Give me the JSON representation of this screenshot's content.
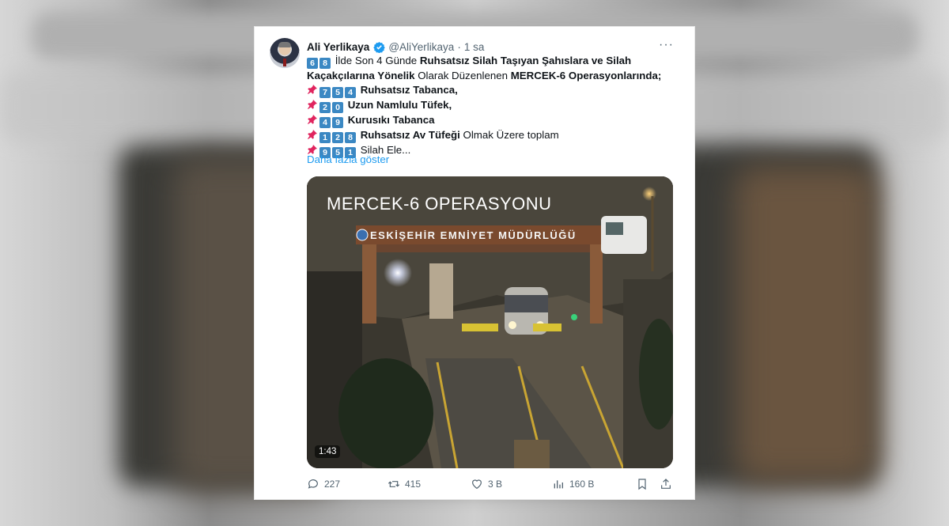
{
  "tweet": {
    "author_name": "Ali Yerlikaya",
    "handle": "@AliYerlikaya",
    "separator": "·",
    "time": "1 sa",
    "more_label": "···",
    "lines": {
      "l1_num": [
        "6",
        "8"
      ],
      "l1_text_a": " İlde Son 4 Günde ",
      "l1_text_b": "Ruhsatsız Silah Taşıyan Şahıslara ve Silah",
      "l2_text_a": "Kaçakçılarına Yönelik",
      "l2_text_b": " Olarak Düzenlenen ",
      "l2_text_c": "MERCEK-6 Operasyonlarında;",
      "l3_num": [
        "7",
        "5",
        "4"
      ],
      "l3_text": " Ruhsatsız Tabanca,",
      "l4_num": [
        "2",
        "0"
      ],
      "l4_text": " Uzun Namlulu Tüfek,",
      "l5_num": [
        "4",
        "9"
      ],
      "l5_text": " Kurusıkı Tabanca",
      "l6_num": [
        "1",
        "2",
        "8"
      ],
      "l6_text_a": " Ruhsatsız Av Tüfeği",
      "l6_text_b": " Olmak Üzere toplam",
      "l7_num": [
        "9",
        "5",
        "1"
      ],
      "l7_text": " Silah Ele..."
    },
    "show_more": "Daha fazla göster",
    "media": {
      "overlay_title": "MERCEK-6 OPERASYONU",
      "sign_text": "ESKİŞEHİR EMNİYET MÜDÜRLÜĞÜ",
      "duration": "1:43"
    },
    "actions": {
      "replies": "227",
      "reposts": "415",
      "likes": "3 B",
      "views": "160 B"
    },
    "colors": {
      "link": "#1d9bf0",
      "secondary": "#536471",
      "keycap": "#3b88c3"
    }
  }
}
